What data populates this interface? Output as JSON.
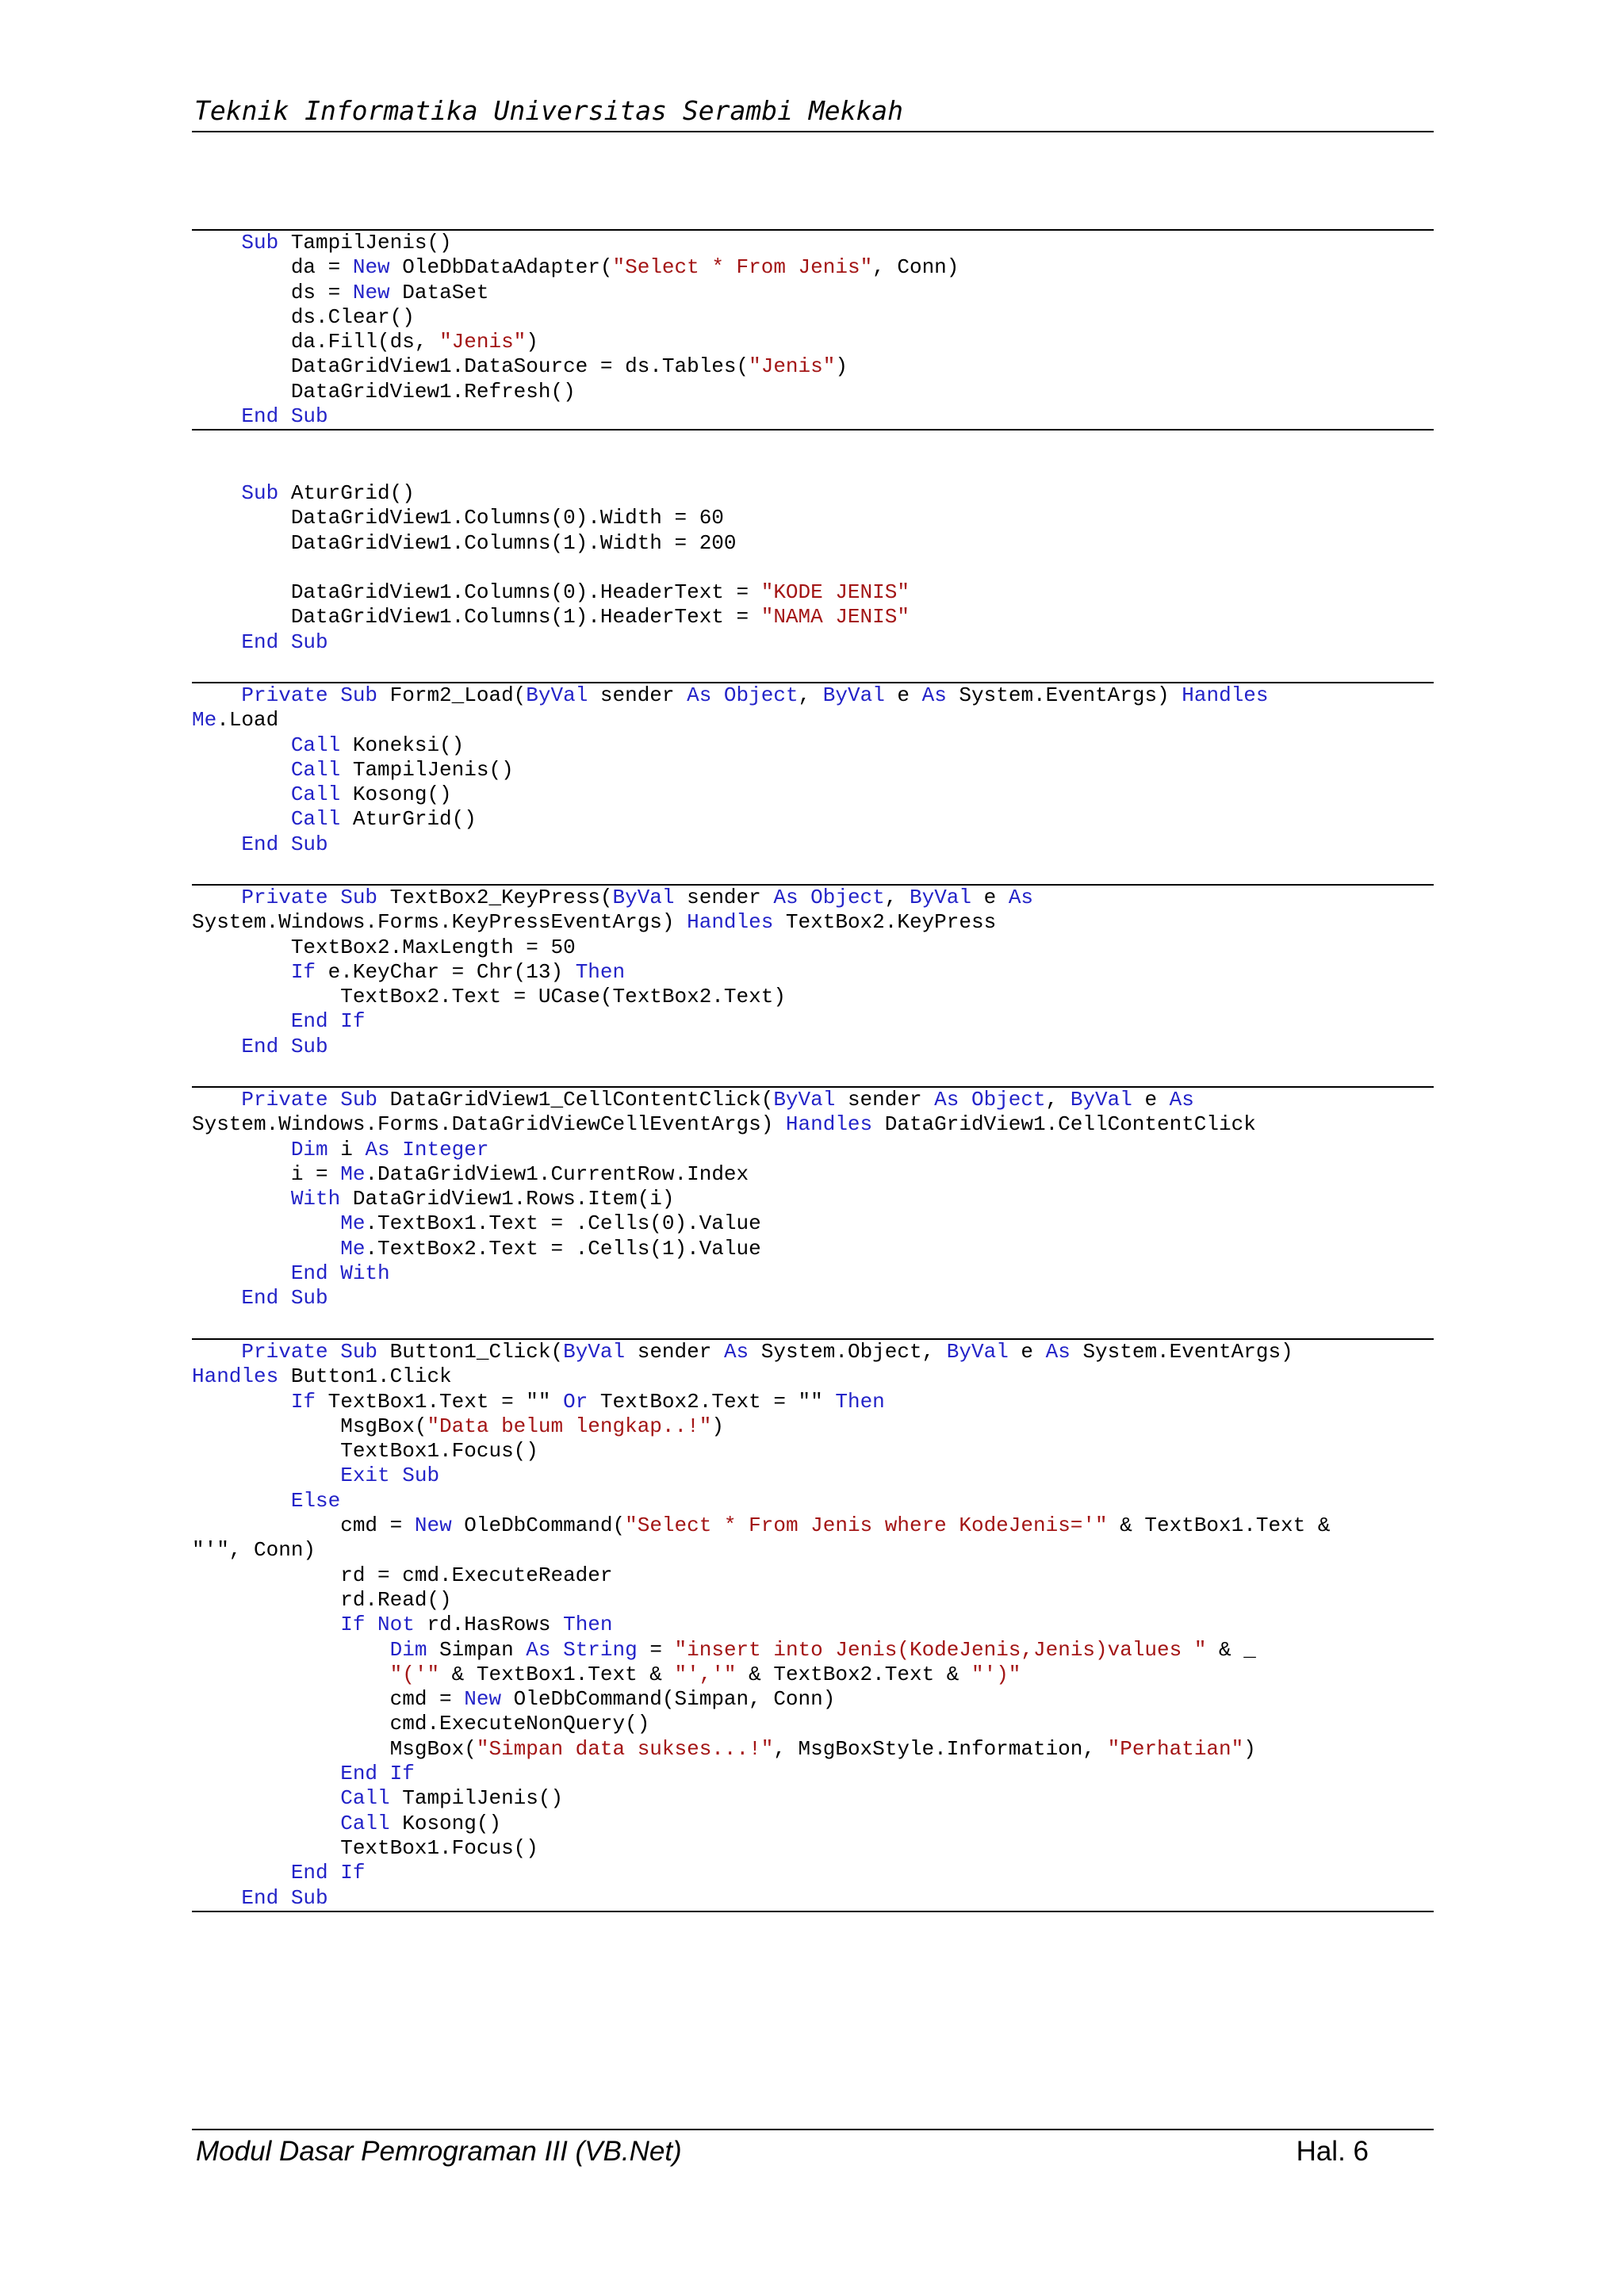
{
  "header": {
    "title": "Teknik Informatika Universitas Serambi Mekkah"
  },
  "footer": {
    "module_title": "Modul Dasar Pemrograman III (VB.Net)",
    "page_number": "Hal. 6"
  },
  "colors": {
    "keyword": "#2323c8",
    "string": "#a31515",
    "text": "#000000"
  },
  "code_blocks": [
    {
      "lines": [
        [
          [
            "k",
            "    Sub"
          ],
          [
            "t",
            " TampilJenis()"
          ]
        ],
        [
          [
            "t",
            "        da = "
          ],
          [
            "k",
            "New"
          ],
          [
            "t",
            " OleDbDataAdapter("
          ],
          [
            "s",
            "\"Select * From Jenis\""
          ],
          [
            "t",
            ", Conn)"
          ]
        ],
        [
          [
            "t",
            "        ds = "
          ],
          [
            "k",
            "New"
          ],
          [
            "t",
            " DataSet"
          ]
        ],
        [
          [
            "t",
            "        ds.Clear()"
          ]
        ],
        [
          [
            "t",
            "        da.Fill(ds, "
          ],
          [
            "s",
            "\"Jenis\""
          ],
          [
            "t",
            ")"
          ]
        ],
        [
          [
            "t",
            "        DataGridView1.DataSource = ds.Tables("
          ],
          [
            "s",
            "\"Jenis\""
          ],
          [
            "t",
            ")"
          ]
        ],
        [
          [
            "t",
            "        DataGridView1.Refresh()"
          ]
        ],
        [
          [
            "k",
            "    End Sub"
          ]
        ]
      ]
    },
    {
      "lines": [
        [
          [
            "k",
            "    Sub"
          ],
          [
            "t",
            " AturGrid()"
          ]
        ],
        [
          [
            "t",
            "        DataGridView1.Columns(0).Width = 60"
          ]
        ],
        [
          [
            "t",
            "        DataGridView1.Columns(1).Width = 200"
          ]
        ],
        [],
        [
          [
            "t",
            "        DataGridView1.Columns(0).HeaderText = "
          ],
          [
            "s",
            "\"KODE JENIS\""
          ]
        ],
        [
          [
            "t",
            "        DataGridView1.Columns(1).HeaderText = "
          ],
          [
            "s",
            "\"NAMA JENIS\""
          ]
        ],
        [
          [
            "k",
            "    End Sub"
          ]
        ]
      ]
    },
    {
      "lines": [
        [
          [
            "k",
            "    Private Sub"
          ],
          [
            "t",
            " Form2_Load("
          ],
          [
            "k",
            "ByVal"
          ],
          [
            "t",
            " sender "
          ],
          [
            "k",
            "As Object"
          ],
          [
            "t",
            ", "
          ],
          [
            "k",
            "ByVal"
          ],
          [
            "t",
            " e "
          ],
          [
            "k",
            "As"
          ],
          [
            "t",
            " System.EventArgs) "
          ],
          [
            "k",
            "Handles"
          ]
        ],
        [
          [
            "k",
            "Me"
          ],
          [
            "t",
            ".Load"
          ]
        ],
        [
          [
            "k",
            "        Call"
          ],
          [
            "t",
            " Koneksi()"
          ]
        ],
        [
          [
            "k",
            "        Call"
          ],
          [
            "t",
            " TampilJenis()"
          ]
        ],
        [
          [
            "k",
            "        Call"
          ],
          [
            "t",
            " Kosong()"
          ]
        ],
        [
          [
            "k",
            "        Call"
          ],
          [
            "t",
            " AturGrid()"
          ]
        ],
        [
          [
            "k",
            "    End Sub"
          ]
        ]
      ]
    },
    {
      "lines": [
        [
          [
            "k",
            "    Private Sub"
          ],
          [
            "t",
            " TextBox2_KeyPress("
          ],
          [
            "k",
            "ByVal"
          ],
          [
            "t",
            " sender "
          ],
          [
            "k",
            "As Object"
          ],
          [
            "t",
            ", "
          ],
          [
            "k",
            "ByVal"
          ],
          [
            "t",
            " e "
          ],
          [
            "k",
            "As"
          ]
        ],
        [
          [
            "t",
            "System.Windows.Forms.KeyPressEventArgs) "
          ],
          [
            "k",
            "Handles"
          ],
          [
            "t",
            " TextBox2.KeyPress"
          ]
        ],
        [
          [
            "t",
            "        TextBox2.MaxLength = 50"
          ]
        ],
        [
          [
            "k",
            "        If"
          ],
          [
            "t",
            " e.KeyChar = Chr(13) "
          ],
          [
            "k",
            "Then"
          ]
        ],
        [
          [
            "t",
            "            TextBox2.Text = UCase(TextBox2.Text)"
          ]
        ],
        [
          [
            "k",
            "        End If"
          ]
        ],
        [
          [
            "k",
            "    End Sub"
          ]
        ]
      ]
    },
    {
      "lines": [
        [
          [
            "k",
            "    Private Sub"
          ],
          [
            "t",
            " DataGridView1_CellContentClick("
          ],
          [
            "k",
            "ByVal"
          ],
          [
            "t",
            " sender "
          ],
          [
            "k",
            "As Object"
          ],
          [
            "t",
            ", "
          ],
          [
            "k",
            "ByVal"
          ],
          [
            "t",
            " e "
          ],
          [
            "k",
            "As"
          ]
        ],
        [
          [
            "t",
            "System.Windows.Forms.DataGridViewCellEventArgs) "
          ],
          [
            "k",
            "Handles"
          ],
          [
            "t",
            " DataGridView1.CellContentClick"
          ]
        ],
        [
          [
            "k",
            "        Dim"
          ],
          [
            "t",
            " i "
          ],
          [
            "k",
            "As Integer"
          ]
        ],
        [
          [
            "t",
            "        i = "
          ],
          [
            "k",
            "Me"
          ],
          [
            "t",
            ".DataGridView1.CurrentRow.Index"
          ]
        ],
        [
          [
            "k",
            "        With"
          ],
          [
            "t",
            " DataGridView1.Rows.Item(i)"
          ]
        ],
        [
          [
            "k",
            "            Me"
          ],
          [
            "t",
            ".TextBox1.Text = .Cells(0).Value"
          ]
        ],
        [
          [
            "k",
            "            Me"
          ],
          [
            "t",
            ".TextBox2.Text = .Cells(1).Value"
          ]
        ],
        [
          [
            "k",
            "        End With"
          ]
        ],
        [
          [
            "k",
            "    End Sub"
          ]
        ]
      ]
    },
    {
      "lines": [
        [
          [
            "k",
            "    Private Sub"
          ],
          [
            "t",
            " Button1_Click("
          ],
          [
            "k",
            "ByVal"
          ],
          [
            "t",
            " sender "
          ],
          [
            "k",
            "As"
          ],
          [
            "t",
            " System.Object, "
          ],
          [
            "k",
            "ByVal"
          ],
          [
            "t",
            " e "
          ],
          [
            "k",
            "As"
          ],
          [
            "t",
            " System.EventArgs)"
          ]
        ],
        [
          [
            "k",
            "Handles"
          ],
          [
            "t",
            " Button1.Click"
          ]
        ],
        [
          [
            "k",
            "        If"
          ],
          [
            "t",
            " TextBox1.Text = \"\" "
          ],
          [
            "k",
            "Or"
          ],
          [
            "t",
            " TextBox2.Text = \"\" "
          ],
          [
            "k",
            "Then"
          ]
        ],
        [
          [
            "t",
            "            MsgBox("
          ],
          [
            "s",
            "\"Data belum lengkap..!\""
          ],
          [
            "t",
            ")"
          ]
        ],
        [
          [
            "t",
            "            TextBox1.Focus()"
          ]
        ],
        [
          [
            "k",
            "            Exit Sub"
          ]
        ],
        [
          [
            "k",
            "        Else"
          ]
        ],
        [
          [
            "t",
            "            cmd = "
          ],
          [
            "k",
            "New"
          ],
          [
            "t",
            " OleDbCommand("
          ],
          [
            "s",
            "\"Select * From Jenis where KodeJenis='\""
          ],
          [
            "t",
            " & TextBox1.Text &"
          ]
        ],
        [
          [
            "t",
            "\"'\", Conn)"
          ]
        ],
        [
          [
            "t",
            "            rd = cmd.ExecuteReader"
          ]
        ],
        [
          [
            "t",
            "            rd.Read()"
          ]
        ],
        [
          [
            "k",
            "            If Not"
          ],
          [
            "t",
            " rd.HasRows "
          ],
          [
            "k",
            "Then"
          ]
        ],
        [
          [
            "k",
            "                Dim"
          ],
          [
            "t",
            " Simpan "
          ],
          [
            "k",
            "As String"
          ],
          [
            "t",
            " = "
          ],
          [
            "s",
            "\"insert into Jenis(KodeJenis,Jenis)values \""
          ],
          [
            "t",
            " & _"
          ]
        ],
        [
          [
            "s",
            "                \"('\""
          ],
          [
            "t",
            " & TextBox1.Text & "
          ],
          [
            "s",
            "\"','\""
          ],
          [
            "t",
            " & TextBox2.Text & "
          ],
          [
            "s",
            "\"')\""
          ]
        ],
        [
          [
            "t",
            "                cmd = "
          ],
          [
            "k",
            "New"
          ],
          [
            "t",
            " OleDbCommand(Simpan, Conn)"
          ]
        ],
        [
          [
            "t",
            "                cmd.ExecuteNonQuery()"
          ]
        ],
        [
          [
            "t",
            "                MsgBox("
          ],
          [
            "s",
            "\"Simpan data sukses...!\""
          ],
          [
            "t",
            ", MsgBoxStyle.Information, "
          ],
          [
            "s",
            "\"Perhatian\""
          ],
          [
            "t",
            ")"
          ]
        ],
        [
          [
            "k",
            "            End If"
          ]
        ],
        [
          [
            "k",
            "            Call"
          ],
          [
            "t",
            " TampilJenis()"
          ]
        ],
        [
          [
            "k",
            "            Call"
          ],
          [
            "t",
            " Kosong()"
          ]
        ],
        [
          [
            "t",
            "            TextBox1.Focus()"
          ]
        ],
        [
          [
            "k",
            "        End If"
          ]
        ],
        [
          [
            "k",
            "    End Sub"
          ]
        ]
      ]
    }
  ]
}
